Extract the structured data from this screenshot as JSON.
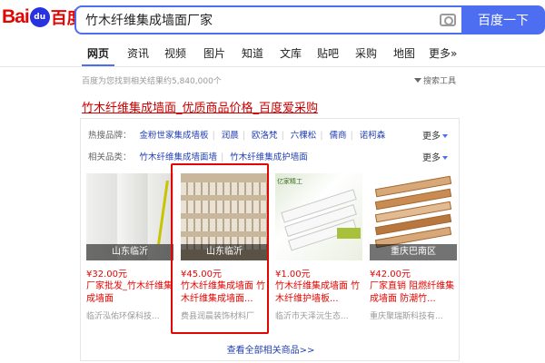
{
  "brand": {
    "logo_latin": "Bai",
    "logo_paw": "du",
    "logo_cn": "百度"
  },
  "search": {
    "query": "竹木纤维集成墙面厂家",
    "button_label": "百度一下",
    "camera_icon": "camera-icon"
  },
  "tabs": [
    {
      "label": "网页",
      "active": true
    },
    {
      "label": "资讯"
    },
    {
      "label": "视频"
    },
    {
      "label": "图片"
    },
    {
      "label": "知道"
    },
    {
      "label": "文库"
    },
    {
      "label": "贴吧"
    },
    {
      "label": "采购"
    },
    {
      "label": "地图"
    },
    {
      "label": "更多»"
    }
  ],
  "meta": {
    "result_count": "百度为您找到相关结果约5,840,000个",
    "tools_label": "搜索工具"
  },
  "ad": {
    "title": "竹木纤维集成墙面_优质商品价格_百度爱采购"
  },
  "card": {
    "hot_brands": {
      "label": "热搜品牌：",
      "items": [
        "金粉世家集成墙板",
        "润晨",
        "欧洛梵",
        "六棵松",
        "儒商",
        "诺柯森"
      ],
      "more": "更多"
    },
    "related": {
      "label": "相关品类：",
      "items": [
        "竹木纤维集成墙面墙",
        "竹木纤维集成护墙面"
      ],
      "more": "更多"
    },
    "products": [
      {
        "location": "山东临沂",
        "price": "¥32.00元",
        "title": "厂家批发_竹木纤维集成墙面",
        "shop": "临沂泓佑环保科技...",
        "image": "white-panel"
      },
      {
        "location": "山东临沂",
        "price": "¥45.00元",
        "title": "竹木纤维集成墙面 竹木纤维集成墙面...",
        "shop": "费县润晨装饰材料厂",
        "image": "beige-boards"
      },
      {
        "location": "",
        "price": "¥1.00元",
        "title": "竹木纤维集成墙面 竹木纤维护墙板...",
        "shop": "临沂市天泽沅生态...",
        "image": "white-grooved-panel"
      },
      {
        "location": "重庆巴南区",
        "price": "¥42.00元",
        "title": "厂家直销 阻燃纤维集成墙面 防潮竹...",
        "shop": "重庆聚瑞斯科技有...",
        "image": "wood-grain-slabs"
      }
    ],
    "view_all": "查看全部相关商品>>",
    "image3_tag": "亿家精工"
  },
  "colors": {
    "accent": "#4e6ef2",
    "ad_red": "#e10602",
    "link_blue": "#2440b3"
  }
}
